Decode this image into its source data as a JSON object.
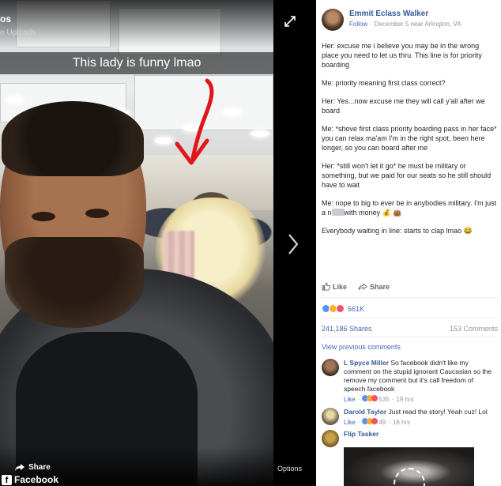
{
  "viewer": {
    "album_title": "os",
    "album_sub": "e Uploads",
    "caption": "This lady is funny lmao",
    "share_label": "Share",
    "brand": "Facebook",
    "options_label": "Options",
    "icons": {
      "expand": "expand-icon",
      "next": "chevron-right-icon",
      "share": "share-arrow-icon",
      "brand": "facebook-logo-icon"
    }
  },
  "post": {
    "author": "Emmit Eclass Walker",
    "follow_label": "Follow",
    "date": "December 5 near Arlington, VA",
    "paragraphs": [
      "Her: excuse me i believe you may be in the wrong place you need to let us thru. This line is for priority boarding",
      "Me: priority meaning first class correct?",
      "Her: Yes...now excuse me they will call y'all after we board",
      "Me: *shove first class priority boarding pass in her face* you can relax ma'am I'm in the right spot, been here longer, so you can board after me",
      "Her: *still won't let it go* he must be military or something, but we paid for our seats so he still should have to wait"
    ],
    "p6_before": "Me: nope to big to ever be in anybodies military. I'm just a n",
    "p6_after": "with money 💰 👜",
    "p7": "Everybody waiting in line: starts to clap lmao 😂",
    "like_label": "Like",
    "share_label": "Share",
    "reaction_count": "661K",
    "shares": "241,186 Shares",
    "comments_count": "153 Comments",
    "view_previous": "View previous comments"
  },
  "comments": [
    {
      "name": "L Spyce Miller",
      "text": "So facebook didn't like my comment on the stupid ignorant Caucasian so the remove my comment but it's call freedom of speech facebook",
      "like": "Like",
      "count": "535",
      "time": "19 hrs"
    },
    {
      "name": "Darold Taylor",
      "text": "Just read the story! Yeah cuz! Lol",
      "like": "Like",
      "count": "49",
      "time": "16 hrs"
    },
    {
      "name": "Flip Tasker",
      "text": ""
    }
  ],
  "colors": {
    "link": "#365899",
    "action_blue": "#4267b2",
    "muted": "#90949c",
    "arrow_red": "#e0161b"
  }
}
